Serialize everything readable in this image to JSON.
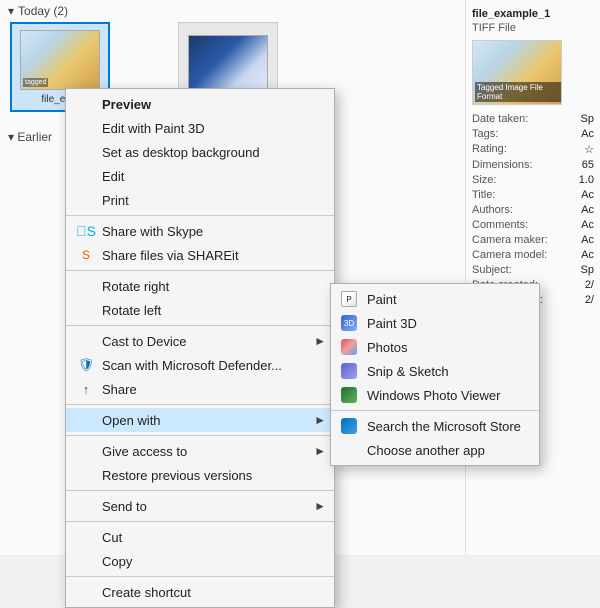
{
  "explorer": {
    "today_header": "Today (2)",
    "earlier_header": "Earlier",
    "file1_label": "file_ex...",
    "file2_label": ""
  },
  "right_panel": {
    "filename": "file_example_1",
    "filetype": "TIFF File",
    "preview_label": "Tagged Image File Format",
    "rows": [
      {
        "key": "Date taken:",
        "val": "Sp"
      },
      {
        "key": "Tags:",
        "val": "Ac"
      },
      {
        "key": "Rating:",
        "val": "☆"
      },
      {
        "key": "Dimensions:",
        "val": "65"
      },
      {
        "key": "Size:",
        "val": "1.0"
      },
      {
        "key": "Title:",
        "val": "Ac"
      },
      {
        "key": "Authors:",
        "val": "Ac"
      },
      {
        "key": "Comments:",
        "val": "Ac"
      },
      {
        "key": "Camera maker:",
        "val": "Ac"
      },
      {
        "key": "Camera model:",
        "val": "Ac"
      },
      {
        "key": "Subject:",
        "val": "Sp"
      },
      {
        "key": "Date created:",
        "val": "2/"
      },
      {
        "key": "Date modified:",
        "val": "2/"
      }
    ]
  },
  "context_menu": {
    "items": [
      {
        "id": "preview",
        "label": "Preview",
        "bold": true,
        "hasIcon": false,
        "hasArrow": false
      },
      {
        "id": "paint3d-edit",
        "label": "Edit with Paint 3D",
        "bold": false,
        "hasIcon": false,
        "hasArrow": false
      },
      {
        "id": "desktop-bg",
        "label": "Set as desktop background",
        "bold": false,
        "hasIcon": false,
        "hasArrow": false
      },
      {
        "id": "edit",
        "label": "Edit",
        "bold": false,
        "hasIcon": false,
        "hasArrow": false
      },
      {
        "id": "print",
        "label": "Print",
        "bold": false,
        "hasIcon": false,
        "hasArrow": false
      },
      {
        "id": "sep1",
        "separator": true
      },
      {
        "id": "skype-share",
        "label": "Share with Skype",
        "bold": false,
        "hasIcon": true,
        "iconType": "skype",
        "hasArrow": false
      },
      {
        "id": "shareit",
        "label": "Share files via SHAREit",
        "bold": false,
        "hasIcon": true,
        "iconType": "shareit",
        "hasArrow": false
      },
      {
        "id": "sep2",
        "separator": true
      },
      {
        "id": "rotate-right",
        "label": "Rotate right",
        "bold": false,
        "hasIcon": false,
        "hasArrow": false
      },
      {
        "id": "rotate-left",
        "label": "Rotate left",
        "bold": false,
        "hasIcon": false,
        "hasArrow": false
      },
      {
        "id": "sep3",
        "separator": true
      },
      {
        "id": "cast",
        "label": "Cast to Device",
        "bold": false,
        "hasIcon": false,
        "hasArrow": true
      },
      {
        "id": "defender",
        "label": "Scan with Microsoft Defender...",
        "bold": false,
        "hasIcon": true,
        "iconType": "defender",
        "hasArrow": false
      },
      {
        "id": "share",
        "label": "Share",
        "bold": false,
        "hasIcon": true,
        "iconType": "share",
        "hasArrow": false
      },
      {
        "id": "sep4",
        "separator": true
      },
      {
        "id": "open-with",
        "label": "Open with",
        "bold": false,
        "hasIcon": false,
        "hasArrow": true,
        "active": true
      },
      {
        "id": "sep5",
        "separator": true
      },
      {
        "id": "give-access",
        "label": "Give access to",
        "bold": false,
        "hasIcon": false,
        "hasArrow": true
      },
      {
        "id": "restore",
        "label": "Restore previous versions",
        "bold": false,
        "hasIcon": false,
        "hasArrow": false
      },
      {
        "id": "sep6",
        "separator": true
      },
      {
        "id": "send-to",
        "label": "Send to",
        "bold": false,
        "hasIcon": false,
        "hasArrow": true
      },
      {
        "id": "sep7",
        "separator": true
      },
      {
        "id": "cut",
        "label": "Cut",
        "bold": false,
        "hasIcon": false,
        "hasArrow": false
      },
      {
        "id": "copy",
        "label": "Copy",
        "bold": false,
        "hasIcon": false,
        "hasArrow": false
      },
      {
        "id": "sep8",
        "separator": true
      },
      {
        "id": "create-shortcut",
        "label": "Create shortcut",
        "bold": false,
        "hasIcon": false,
        "hasArrow": false
      }
    ]
  },
  "submenu": {
    "items": [
      {
        "id": "paint",
        "label": "Paint",
        "iconType": "paint"
      },
      {
        "id": "paint3d",
        "label": "Paint 3D",
        "iconType": "paint3d"
      },
      {
        "id": "photos",
        "label": "Photos",
        "iconType": "photos"
      },
      {
        "id": "snip",
        "label": "Snip & Sketch",
        "iconType": "snip"
      },
      {
        "id": "wpv",
        "label": "Windows Photo Viewer",
        "iconType": "wpv"
      },
      {
        "id": "sep-sub",
        "separator": true
      },
      {
        "id": "store",
        "label": "Search the Microsoft Store",
        "iconType": "store"
      },
      {
        "id": "choose",
        "label": "Choose another app",
        "iconType": null
      }
    ]
  }
}
